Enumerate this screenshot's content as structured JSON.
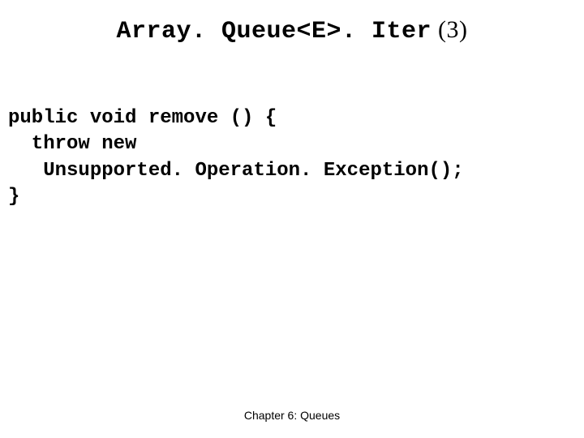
{
  "title": {
    "mono": "Array. Queue<E>. Iter",
    "suffix": " (3)"
  },
  "code": {
    "l1": "public void remove () {",
    "l2": "  throw new",
    "l3": "   Unsupported. Operation. Exception();",
    "l4": "}"
  },
  "footer": "Chapter 6: Queues"
}
